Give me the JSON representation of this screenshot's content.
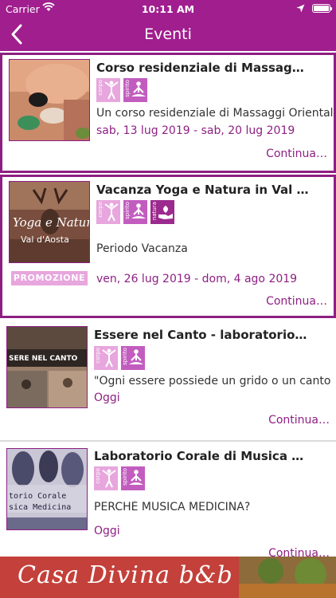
{
  "status": {
    "carrier": "Carrier",
    "time": "10:11 AM"
  },
  "header": {
    "title": "Eventi"
  },
  "events": [
    {
      "title": "Corso residenziale di Massaggi orien…",
      "badges": [
        "corpo",
        "spirito"
      ],
      "description": "Un corso residenziale di Massaggi Orientali",
      "date": "sab, 13 lug 2019 - sab, 20 lug 2019",
      "more": "Continua…"
    },
    {
      "title": "Vacanza Yoga e Natura in Val d'Aost…",
      "badges": [
        "corpo",
        "spirito",
        "natura"
      ],
      "description": "Periodo Vacanza",
      "date": "ven, 26 lug 2019 - dom, 4 ago 2019",
      "promo": "PROMOZIONE",
      "thumb_texts": [
        "Yoga e Natura",
        "Val d'Aosta"
      ],
      "more": "Continua…"
    },
    {
      "title": "Essere nel Canto - laboratorio di Voc…",
      "badges": [
        "corpo",
        "spirito"
      ],
      "description": "\"Ogni essere possiede un grido o un canto",
      "date": "Oggi",
      "thumb_texts": [
        "SERE NEL CANTO"
      ],
      "more": "Continua…"
    },
    {
      "title": "Laboratorio Corale di Musica Medici…",
      "badges": [
        "corpo",
        "spirito"
      ],
      "description": "PERCHÈ MUSICA MEDICINA?",
      "date": "Oggi",
      "thumb_texts": [
        "torio Corale",
        "sica Medicina"
      ],
      "more": "Continua…"
    }
  ],
  "banner": {
    "text": "Casa Divina b&b"
  },
  "colors": {
    "brand": "#a01e8e",
    "accent": "#8e1f82",
    "badge_light": "#e7a6dd",
    "badge_dark": "#c25dbf"
  }
}
